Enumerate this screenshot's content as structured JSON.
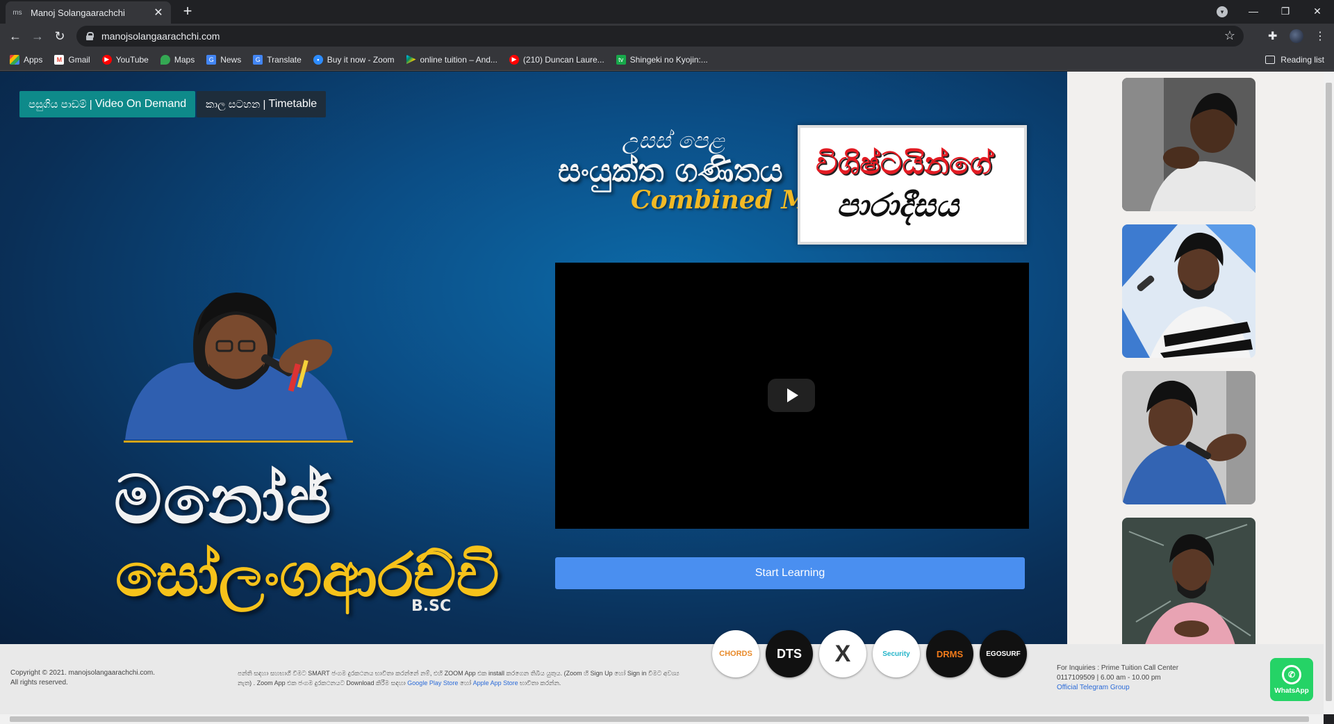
{
  "browser": {
    "tab_title": "Manoj Solangaarachchi",
    "tab_close": "✕",
    "new_tab": "+",
    "url": "manojsolangaarachchi.com",
    "reading_list": "Reading list"
  },
  "bookmarks": [
    {
      "label": "Apps",
      "icon": "apps-grid-icon",
      "color": "#4285f4"
    },
    {
      "label": "Gmail",
      "icon": "gmail-icon",
      "color": "#ea4335"
    },
    {
      "label": "YouTube",
      "icon": "youtube-icon",
      "color": "#ff0000"
    },
    {
      "label": "Maps",
      "icon": "maps-icon",
      "color": "#34a853"
    },
    {
      "label": "News",
      "icon": "news-icon",
      "color": "#4285f4"
    },
    {
      "label": "Translate",
      "icon": "translate-icon",
      "color": "#4285f4"
    },
    {
      "label": "Buy it now - Zoom",
      "icon": "zoom-icon",
      "color": "#2d8cff"
    },
    {
      "label": "online tuition – And...",
      "icon": "play-store-icon",
      "color": "#01875f"
    },
    {
      "label": "(210) Duncan Laure...",
      "icon": "youtube-icon",
      "color": "#ff0000"
    },
    {
      "label": "Shingeki no Kyojin:...",
      "icon": "tv-icon",
      "color": "#17a84a"
    }
  ],
  "hero": {
    "vod_button_si": "පසුගිය පාඩම් | ",
    "vod_button_en": "Video On Demand",
    "timetable_button_si": "කාල සටහන | ",
    "timetable_button_en": "Timetable",
    "name_line1": "මනෝජ්",
    "name_line2": "සෝලංගආරච්චි",
    "degree": "B.SC",
    "subject_small": "උසස් පෙළ",
    "subject_main": "සංයුක්ත ගණිතය",
    "subject_en": "Combined Maths",
    "logo_line1": "විශිෂ්ටයින්ගේ",
    "logo_line2": "පාරාදීසය",
    "start_button": "Start Learning"
  },
  "footer": {
    "copyright_line1": "Copyright © 2021. manojsolangaarachchi.com.",
    "copyright_line2": "All rights reserved.",
    "desc_text": "පන්ති සඳහා සහභාගී වීමට SMART ජංගම දුරකථනය භාවිතා කරන්නේ නම්, එහි ZOOM App එක install කරගෙන තිබිය යුතුය. (Zoom හි Sign Up හෝ Sign in වීමට අවශ්‍ය නැත) . Zoom App එක ජංගම දුරකථනයට Download කිරීම සඳහා",
    "google_play": "Google Play Store",
    "or_text": "හෝ",
    "apple_store": "Apple App Store",
    "desc_end": "භාවිතා කරන්න.",
    "inquiries": "For Inquiries : Prime Tuition Call Center",
    "phone": "0117109509 | 6.00 am - 10.00 pm",
    "telegram": "Official Telegram Group",
    "whatsapp": "WhatsApp",
    "partners": [
      {
        "name": "chords-logo",
        "label": "CHORDS",
        "bg": "#ffffff",
        "fg": "#e88a2a"
      },
      {
        "name": "dts-logo",
        "label": "DTS",
        "bg": "#111111",
        "fg": "#ffffff"
      },
      {
        "name": "x-logo",
        "label": "X",
        "bg": "#ffffff",
        "fg": "#333333"
      },
      {
        "name": "security-logo",
        "label": "Security",
        "bg": "#ffffff",
        "fg": "#23b4c9"
      },
      {
        "name": "drms-logo",
        "label": "DRMS",
        "bg": "#111111",
        "fg": "#f07a1a"
      },
      {
        "name": "egosurf-logo",
        "label": "EGOSURF",
        "bg": "#111111",
        "fg": "#ffffff"
      }
    ]
  }
}
